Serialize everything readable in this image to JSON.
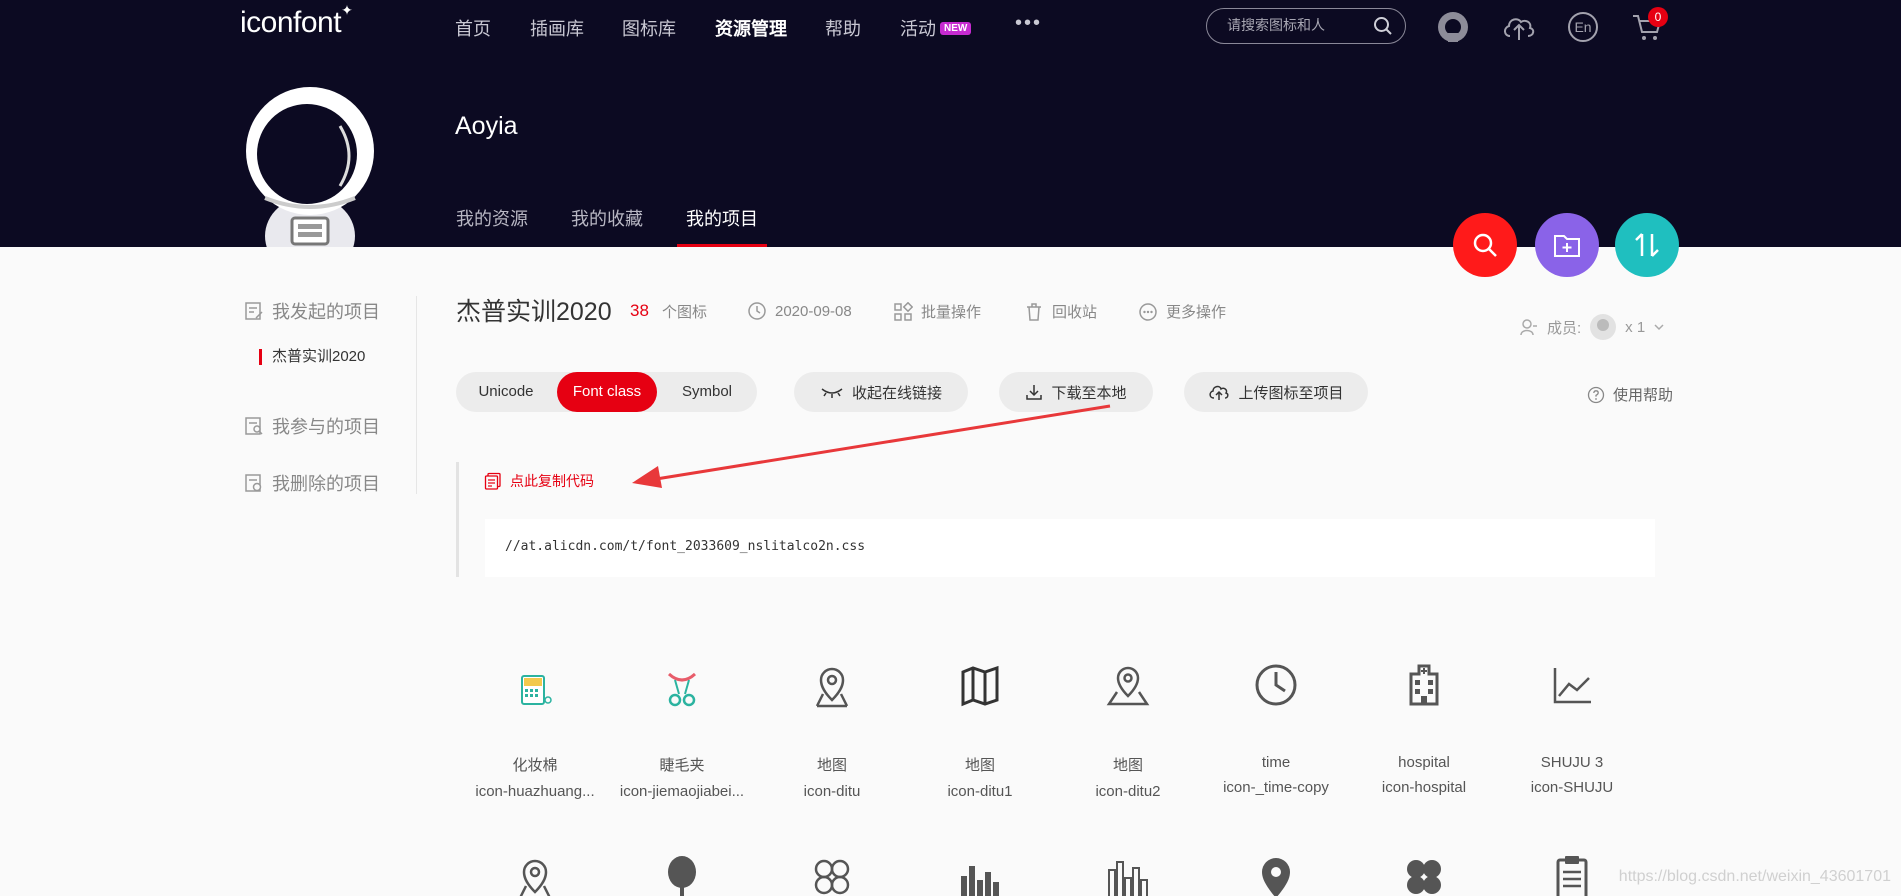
{
  "header": {
    "logo": "iconfont",
    "nav": [
      "首页",
      "插画库",
      "图标库",
      "资源管理",
      "帮助",
      "活动"
    ],
    "active_nav": "资源管理",
    "new_badge": "NEW",
    "more": "•••",
    "search_placeholder": "请搜索图标和人",
    "lang": "En",
    "cart_count": "0"
  },
  "profile": {
    "username": "Aoyia",
    "tabs": [
      "我的资源",
      "我的收藏",
      "我的项目"
    ],
    "active_tab": "我的项目"
  },
  "sidebar": {
    "my_projects": "我发起的项目",
    "current_project": "杰普实训2020",
    "joined_projects": "我参与的项目",
    "deleted_projects": "我删除的项目"
  },
  "project": {
    "title": "杰普实训2020",
    "count": "38",
    "count_unit": "个图标",
    "date": "2020-09-08",
    "batch": "批量操作",
    "recycle": "回收站",
    "more": "更多操作",
    "members_label": "成员:",
    "members_count": "x 1"
  },
  "toolbar": {
    "formats": [
      "Unicode",
      "Font class",
      "Symbol"
    ],
    "active_format": "Font class",
    "collapse_link": "收起在线链接",
    "download": "下载至本地",
    "upload": "上传图标至项目",
    "help": "使用帮助"
  },
  "code": {
    "copy_label": "点此复制代码",
    "url": "//at.alicdn.com/t/font_2033609_nslitalco2n.css"
  },
  "icons": [
    {
      "name": "化妆棉",
      "code": "icon-huazhuang...",
      "glyph": "cotton-pad-icon",
      "color": "#2bb3a0"
    },
    {
      "name": "睫毛夹",
      "code": "icon-jiemaojiabei...",
      "glyph": "eyelash-curler-icon",
      "color": "#2bb3a0"
    },
    {
      "name": "地图",
      "code": "icon-ditu",
      "glyph": "map-pin-icon",
      "color": "#555555"
    },
    {
      "name": "地图",
      "code": "icon-ditu1",
      "glyph": "folded-map-icon",
      "color": "#333333"
    },
    {
      "name": "地图",
      "code": "icon-ditu2",
      "glyph": "map-location-icon",
      "color": "#555555"
    },
    {
      "name": "time",
      "code": "icon-_time-copy",
      "glyph": "clock-icon",
      "color": "#555555"
    },
    {
      "name": "hospital",
      "code": "icon-hospital",
      "glyph": "hospital-icon",
      "color": "#555555"
    },
    {
      "name": "SHUJU 3",
      "code": "icon-SHUJU",
      "glyph": "line-chart-icon",
      "color": "#555555"
    }
  ],
  "icons_row2": [
    "location-icon",
    "pin-icon",
    "clover-outline-icon",
    "bar-chart-icon",
    "bar-chart-outline-icon",
    "marker-icon",
    "clover-filled-icon",
    "clipboard-icon"
  ],
  "watermark": "https://blog.csdn.net/weixin_43601701",
  "colors": {
    "brand_red": "#e60012",
    "header_bg": "#0c0a22",
    "fab_search": "#ff1a1a",
    "fab_folder": "#8a63e8",
    "fab_sort": "#1fbfbf"
  }
}
